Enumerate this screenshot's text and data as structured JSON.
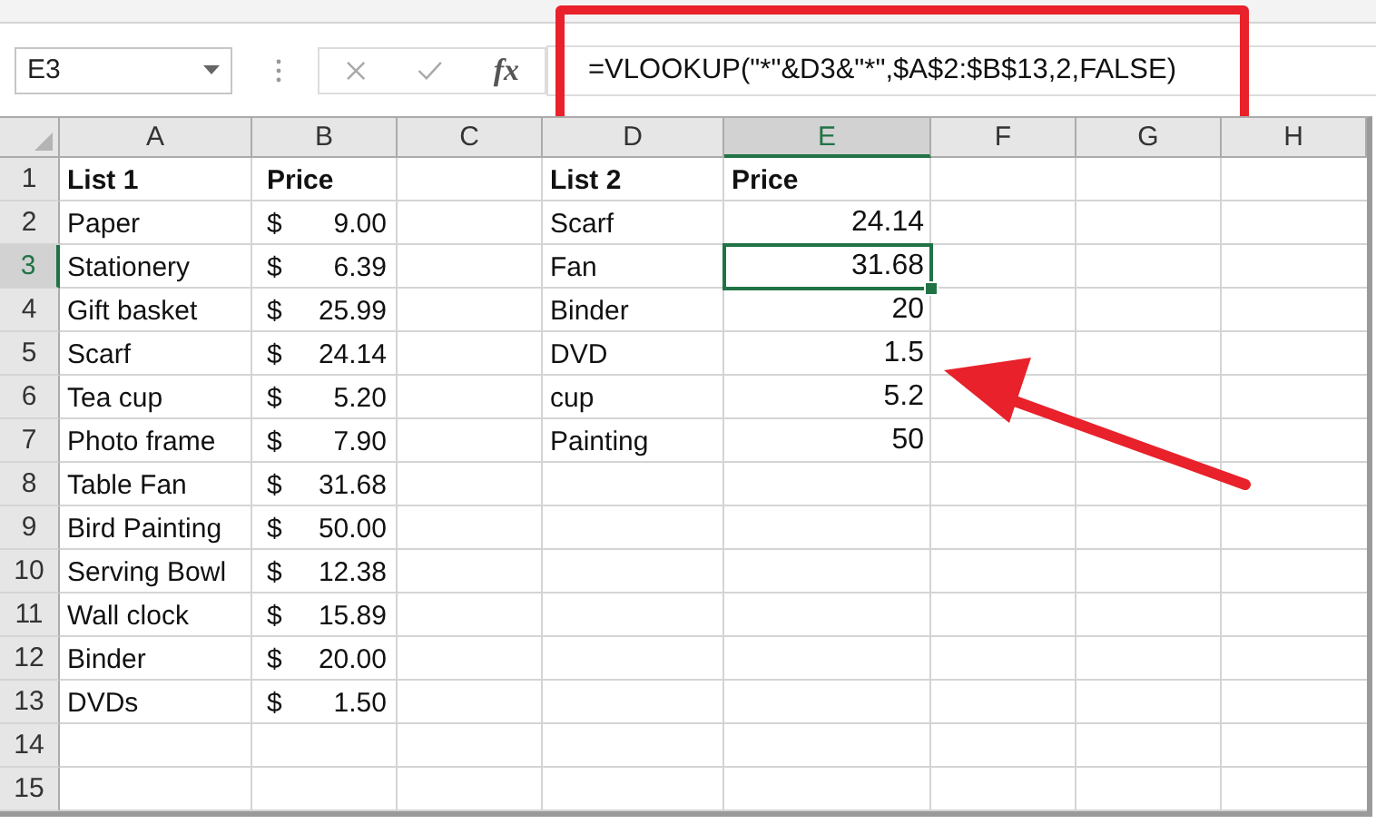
{
  "name_box": {
    "value": "E3"
  },
  "formula_bar": {
    "fx": "fx",
    "formula": "=VLOOKUP(\"*\"&D3&\"*\",$A$2:$B$13,2,FALSE)"
  },
  "columns": [
    {
      "label": "A",
      "selected": false
    },
    {
      "label": "B",
      "selected": false
    },
    {
      "label": "C",
      "selected": false
    },
    {
      "label": "D",
      "selected": false
    },
    {
      "label": "E",
      "selected": true
    },
    {
      "label": "F",
      "selected": false
    },
    {
      "label": "G",
      "selected": false
    },
    {
      "label": "H",
      "selected": false
    }
  ],
  "rows": [
    {
      "number": "1",
      "selected": false,
      "kind": "header",
      "a": "List 1",
      "b_amount": "Price",
      "d": "List 2",
      "e": "Price"
    },
    {
      "number": "2",
      "selected": false,
      "kind": "data",
      "a": "Paper",
      "b_symbol": "$",
      "b_amount": "9.00",
      "d": "Scarf",
      "e": "24.14"
    },
    {
      "number": "3",
      "selected": true,
      "kind": "data",
      "a": "Stationery",
      "b_symbol": "$",
      "b_amount": "6.39",
      "d": "Fan",
      "e": "31.68"
    },
    {
      "number": "4",
      "selected": false,
      "kind": "data",
      "a": "Gift basket",
      "b_symbol": "$",
      "b_amount": "25.99",
      "d": "Binder",
      "e": "20"
    },
    {
      "number": "5",
      "selected": false,
      "kind": "data",
      "a": "Scarf",
      "b_symbol": "$",
      "b_amount": "24.14",
      "d": "DVD",
      "e": "1.5"
    },
    {
      "number": "6",
      "selected": false,
      "kind": "data",
      "a": "Tea cup",
      "b_symbol": "$",
      "b_amount": "5.20",
      "d": "cup",
      "e": "5.2"
    },
    {
      "number": "7",
      "selected": false,
      "kind": "data",
      "a": "Photo frame",
      "b_symbol": "$",
      "b_amount": "7.90",
      "d": "Painting",
      "e": "50"
    },
    {
      "number": "8",
      "selected": false,
      "kind": "data",
      "a": "Table Fan",
      "b_symbol": "$",
      "b_amount": "31.68"
    },
    {
      "number": "9",
      "selected": false,
      "kind": "data",
      "a": "Bird Painting",
      "b_symbol": "$",
      "b_amount": "50.00"
    },
    {
      "number": "10",
      "selected": false,
      "kind": "data",
      "a": "Serving Bowl",
      "b_symbol": "$",
      "b_amount": "12.38"
    },
    {
      "number": "11",
      "selected": false,
      "kind": "data",
      "a": "Wall clock",
      "b_symbol": "$",
      "b_amount": "15.89"
    },
    {
      "number": "12",
      "selected": false,
      "kind": "data",
      "a": "Binder",
      "b_symbol": "$",
      "b_amount": "20.00"
    },
    {
      "number": "13",
      "selected": false,
      "kind": "data",
      "a": "DVDs",
      "b_symbol": "$",
      "b_amount": "1.50"
    },
    {
      "number": "14",
      "selected": false
    },
    {
      "number": "15",
      "selected": false
    }
  ]
}
